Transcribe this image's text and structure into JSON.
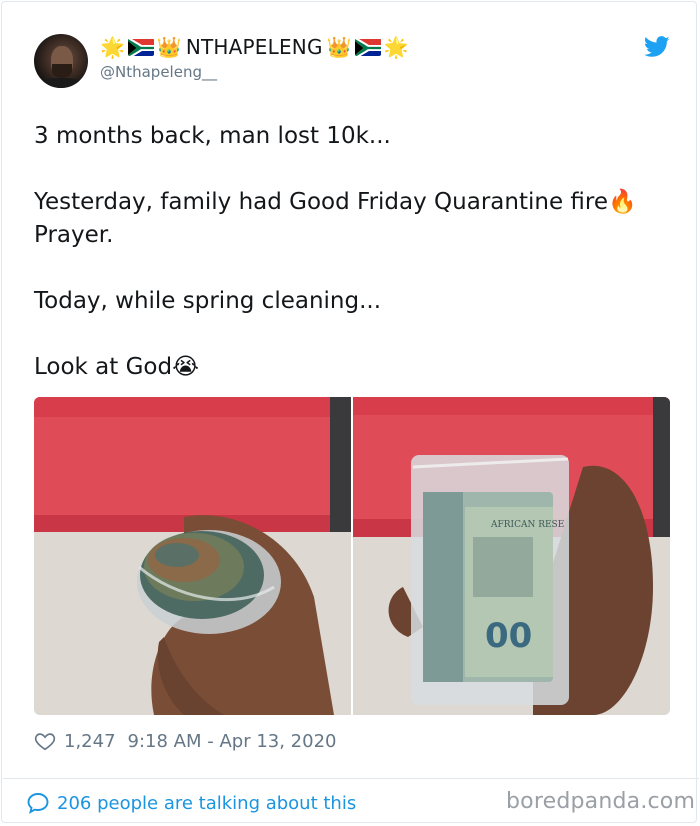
{
  "author": {
    "display_name": "NTHAPELENG",
    "handle": "@Nthapeleng__",
    "name_emoji_left": [
      "🌟",
      "flag-za",
      "👑"
    ],
    "name_emoji_right": [
      "👑",
      "flag-za",
      "🌟"
    ]
  },
  "tweet": {
    "lines": [
      "3 months back, man lost 10k...",
      "Yesterday, family had Good Friday Quarantine fire🔥 Prayer.",
      "Today, while spring cleaning...",
      "Look at God😭"
    ],
    "line1": "3 months back, man lost 10k...",
    "line2a": "Yesterday, family had Good Friday Quarantine fire",
    "line2_emoji": "🔥",
    "line2b": "Prayer.",
    "line3": "Today, while spring cleaning...",
    "line4": "Look at God",
    "line4_emoji": "😭"
  },
  "photos": {
    "left_alt": "rolled banknotes in a plastic bag held in a hand",
    "right_alt": "bundle of banknotes in a ziplock bag held upright in a hand",
    "banknote_text": "AFRICAN RESE",
    "banknote_denomination": "00"
  },
  "meta": {
    "likes": "1,247",
    "timestamp": "9:18 AM - Apr 13, 2020"
  },
  "footer": {
    "talking_text": "206 people are talking about this",
    "watermark": "boredpanda.com"
  },
  "colors": {
    "twitter_blue": "#1da1f2",
    "link_blue": "#1b95e0",
    "muted_gray": "#657786",
    "wall_red": "#e04b58"
  },
  "icons": [
    "twitter-bird-icon",
    "heart-icon",
    "speech-bubble-icon",
    "flag-za-icon",
    "star-emoji",
    "crown-emoji",
    "fire-emoji",
    "crying-emoji"
  ]
}
